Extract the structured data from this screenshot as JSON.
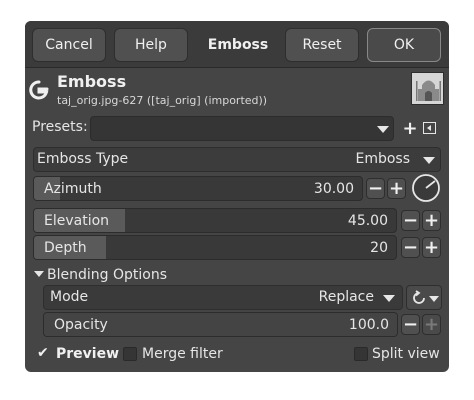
{
  "header": {
    "cancel": "Cancel",
    "help": "Help",
    "title": "Emboss",
    "reset": "Reset",
    "ok": "OK"
  },
  "filter": {
    "name": "Emboss",
    "source": "taj_orig.jpg-627 ([taj_orig] (imported))"
  },
  "presets": {
    "label": "Presets:",
    "value": ""
  },
  "emboss_type": {
    "label": "Emboss Type",
    "value": "Emboss"
  },
  "azimuth": {
    "label": "Azimuth",
    "value": "30.00",
    "fraction": 0.08
  },
  "elevation": {
    "label": "Elevation",
    "value": "45.00",
    "fraction": 0.25
  },
  "depth": {
    "label": "Depth",
    "value": "20",
    "fraction": 0.2
  },
  "blending": {
    "section_label": "Blending Options",
    "mode_label": "Mode",
    "mode_value": "Replace",
    "opacity_label": "Opacity",
    "opacity_value": "100.0",
    "opacity_fraction": 1.0
  },
  "footer": {
    "preview": "Preview",
    "merge": "Merge filter",
    "split": "Split view"
  }
}
